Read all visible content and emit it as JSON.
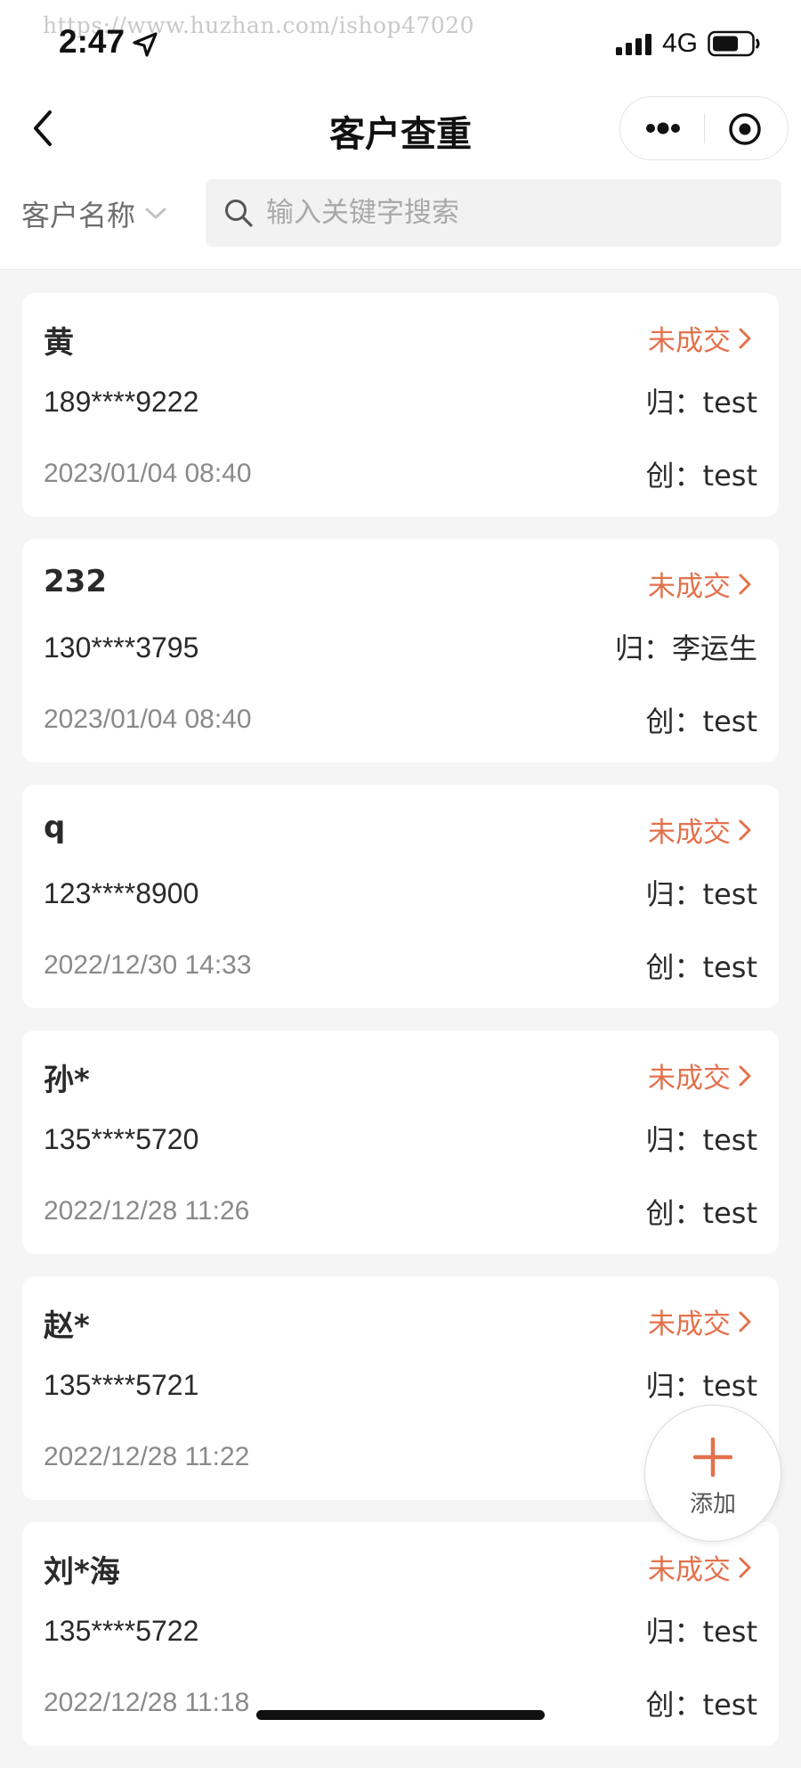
{
  "watermark": "https://www.huzhan.com/ishop47020",
  "status_bar": {
    "time": "2:47",
    "network": "4G"
  },
  "header": {
    "title": "客户查重"
  },
  "filter": {
    "field_label": "客户名称",
    "search_placeholder": "输入关键字搜索",
    "search_value": ""
  },
  "colors": {
    "status_accent": "#e3714c",
    "background": "#f5f5f5"
  },
  "customers": [
    {
      "name": "黄",
      "status": "未成交",
      "phone": "189****9222",
      "owner": "归：test",
      "date": "2023/01/04 08:40",
      "creator": "创：test"
    },
    {
      "name": "232",
      "status": "未成交",
      "phone": "130****3795",
      "owner": "归：李运生",
      "date": "2023/01/04 08:40",
      "creator": "创：test"
    },
    {
      "name": "q",
      "status": "未成交",
      "phone": "123****8900",
      "owner": "归：test",
      "date": "2022/12/30 14:33",
      "creator": "创：test"
    },
    {
      "name": "孙*",
      "status": "未成交",
      "phone": "135****5720",
      "owner": "归：test",
      "date": "2022/12/28 11:26",
      "creator": "创：test"
    },
    {
      "name": "赵*",
      "status": "未成交",
      "phone": "135****5721",
      "owner": "归：test",
      "date": "2022/12/28 11:22",
      "creator": ""
    },
    {
      "name": "刘*海",
      "status": "未成交",
      "phone": "135****5722",
      "owner": "归：test",
      "date": "2022/12/28 11:18",
      "creator": "创：test"
    }
  ],
  "fab": {
    "label": "添加"
  }
}
